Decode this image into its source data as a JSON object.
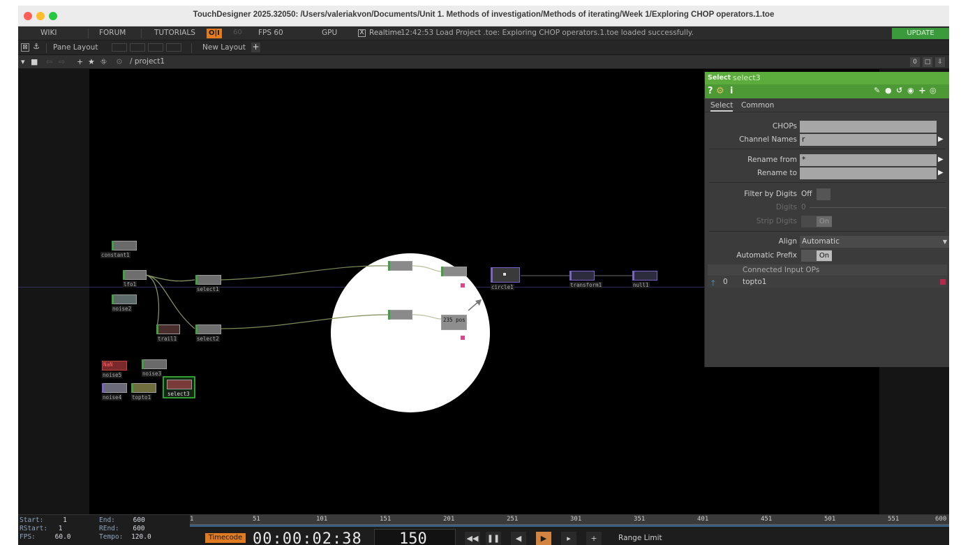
{
  "window": {
    "title": "TouchDesigner 2025.32050: /Users/valeriakvon/Documents/Unit 1. Methods of investigation/Methods of iterating/Week 1/Exploring CHOP operators.1.toe"
  },
  "menubar": {
    "wiki": "WIKI",
    "forum": "FORUM",
    "tutorials": "TUTORIALS",
    "oi": "O|I",
    "oi_value": "60",
    "fps_label": "FPS 60",
    "gpu": "GPU",
    "realtime_checkbox": "X",
    "realtime": "Realtime",
    "status": "12:42:53 Load Project .toe: Exploring CHOP operators.1.toe loaded successfully.",
    "update": "UPDATE"
  },
  "toolbar": {
    "pane_layout": "Pane Layout",
    "new_layout": "New Layout",
    "plus": "+"
  },
  "pathbar": {
    "path": "/ project1",
    "right_value": "0"
  },
  "nodes": [
    {
      "id": "constant1",
      "label": "constant1"
    },
    {
      "id": "lfo1",
      "label": "lfo1"
    },
    {
      "id": "noise2",
      "label": "noise2"
    },
    {
      "id": "select1",
      "label": "select1"
    },
    {
      "id": "trail1",
      "label": "trail1"
    },
    {
      "id": "select2",
      "label": "select2"
    },
    {
      "id": "noise5",
      "label": "noise5"
    },
    {
      "id": "noise3",
      "label": "noise3"
    },
    {
      "id": "noise4",
      "label": "noise4"
    },
    {
      "id": "topto1",
      "label": "topto1"
    },
    {
      "id": "select3",
      "label": "select3"
    },
    {
      "id": "circle1",
      "label": "circle1"
    },
    {
      "id": "transform1",
      "label": "transform1"
    },
    {
      "id": "null1",
      "label": "null1"
    }
  ],
  "node_previews": {
    "pos_label": "235 pos",
    "warn_label": "NaN"
  },
  "param_panel": {
    "op_type": "Select",
    "op_name": "select3",
    "help_icon": "?",
    "info_icon": "i",
    "tabs": [
      "Select",
      "Common"
    ],
    "params": {
      "chops_label": "CHOPs",
      "chops_value": "",
      "channel_names_label": "Channel Names",
      "channel_names_value": "r",
      "rename_from_label": "Rename from",
      "rename_from_value": "*",
      "rename_to_label": "Rename to",
      "rename_to_value": "",
      "filter_by_digits_label": "Filter by Digits",
      "filter_by_digits_value": "Off",
      "digits_label": "Digits",
      "digits_value": "0",
      "strip_digits_label": "Strip Digits",
      "strip_digits_value": "On",
      "align_label": "Align",
      "align_value": "Automatic",
      "automatic_prefix_label": "Automatic Prefix",
      "automatic_prefix_value": "On"
    },
    "connected": {
      "header": "Connected Input OPs",
      "index": "0",
      "name": "topto1"
    }
  },
  "timeline": {
    "start_label": "Start:",
    "start": "1",
    "end_label": "End:",
    "end": "600",
    "rstart_label": "RStart:",
    "rstart": "1",
    "rend_label": "REnd:",
    "rend": "600",
    "fps_label": "FPS:",
    "fps": "60.0",
    "tempo_label": "Tempo:",
    "tempo": "120.0",
    "ticks": [
      "1",
      "51",
      "101",
      "151",
      "201",
      "251",
      "301",
      "351",
      "401",
      "451",
      "501",
      "551",
      "600"
    ],
    "timecode_label": "Timecode",
    "timecode": "00:00:02:38",
    "frame": "150",
    "range_limit": "Range Limit"
  },
  "colors": {
    "chop_green": "#5cac3d",
    "timecode_orange": "#e07b22",
    "update_green": "#3b9a3b"
  }
}
